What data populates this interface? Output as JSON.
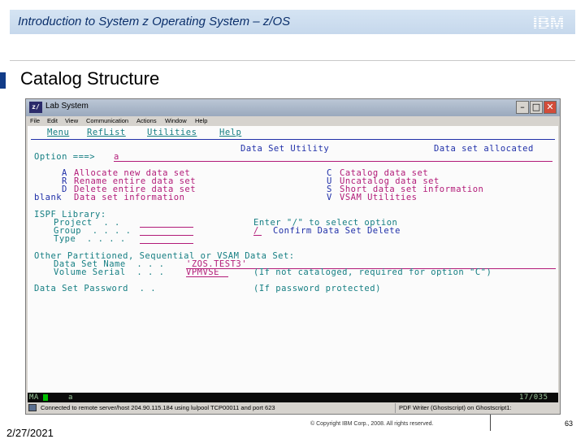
{
  "slide": {
    "header_title": "Introduction to System z Operating System – z/OS",
    "logo_text": "IBM",
    "title": "Catalog Structure",
    "footer_date": "2/27/2021",
    "footer_copyright": "© Copyright IBM Corp., 2008. All rights reserved.",
    "page_number": "63"
  },
  "window": {
    "app_icon": "z/",
    "title": "Lab System",
    "controls": [
      "minimize-icon",
      "maximize-icon",
      "close-icon"
    ],
    "minimize": "–",
    "maximize": "□",
    "close": "✕",
    "menus": [
      "File",
      "Edit",
      "View",
      "Communication",
      "Actions",
      "Window",
      "Help"
    ]
  },
  "terminal": {
    "action_bar": [
      "Menu",
      "RefList",
      "Utilities",
      "Help"
    ],
    "panel_title": "Data Set Utility",
    "short_message": "Data set allocated",
    "option_label": "Option ===>",
    "option_value": "a",
    "options_left": [
      {
        "key": "A",
        "desc": "Allocate new data set"
      },
      {
        "key": "R",
        "desc": "Rename entire data set"
      },
      {
        "key": "D",
        "desc": "Delete entire data set"
      },
      {
        "key": "blank",
        "desc": "Data set information"
      }
    ],
    "options_right": [
      {
        "key": "C",
        "desc": "Catalog data set"
      },
      {
        "key": "U",
        "desc": "Uncatalog data set"
      },
      {
        "key": "S",
        "desc": "Short data set information"
      },
      {
        "key": "V",
        "desc": "VSAM Utilities"
      }
    ],
    "ispf_library": "ISPF Library:",
    "project_label": "Project  . .",
    "group_label": "Group  . . . .",
    "type_label": "Type  . . . .",
    "enter_select": "Enter \"/\" to select option",
    "confirm_value": "/",
    "confirm_label": "Confirm Data Set Delete",
    "other_heading": "Other Partitioned, Sequential or VSAM Data Set:",
    "dsname_label": "Data Set Name  . . .",
    "dsname_value": "'ZOS.TEST3'",
    "volser_label": "Volume Serial  . . .",
    "volser_value": "VPMVSE",
    "volser_note": "(If not cataloged, required for option \"C\")",
    "password_label": "Data Set Password  . .",
    "password_note": "(If password protected)"
  },
  "oia": {
    "indicator": "MA",
    "typed": "a",
    "cursor_pos": "17/035"
  },
  "statusbar": {
    "connection": "Connected to remote server/host 204.90.115.184 using lu/pool TCP00011 and port 623",
    "printer": "PDF Writer (Ghostscript) on Ghostscript1:"
  }
}
